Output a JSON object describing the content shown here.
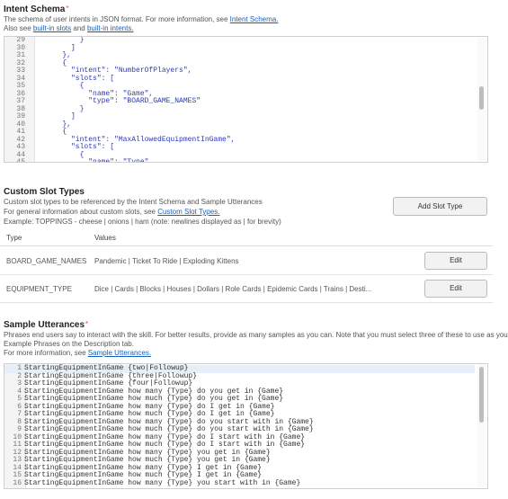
{
  "intent_schema": {
    "title": "Intent Schema",
    "required_mark": "*",
    "desc1_prefix": "The schema of user intents in JSON format. For more information, see ",
    "desc1_link": "Intent Schema.",
    "desc2_prefix": "Also see ",
    "desc2_link1": "built-in slots",
    "desc2_mid": " and ",
    "desc2_link2": "built-in intents.",
    "lines": [
      {
        "n": "29",
        "t": "            }"
      },
      {
        "n": "30",
        "t": "          ]"
      },
      {
        "n": "31",
        "t": "        },"
      },
      {
        "n": "32",
        "t": "        {"
      },
      {
        "n": "33",
        "t": "          \"intent\": \"NumberOfPlayers\","
      },
      {
        "n": "34",
        "t": "          \"slots\": ["
      },
      {
        "n": "35",
        "t": "            {"
      },
      {
        "n": "36",
        "t": "              \"name\": \"Game\","
      },
      {
        "n": "37",
        "t": "              \"type\": \"BOARD_GAME_NAMES\""
      },
      {
        "n": "38",
        "t": "            }"
      },
      {
        "n": "39",
        "t": "          ]"
      },
      {
        "n": "40",
        "t": "        },"
      },
      {
        "n": "41",
        "t": "        {"
      },
      {
        "n": "42",
        "t": "          \"intent\": \"MaxAllowedEquipmentInGame\","
      },
      {
        "n": "43",
        "t": "          \"slots\": ["
      },
      {
        "n": "44",
        "t": "            {"
      },
      {
        "n": "45",
        "t": "              \"name\": \"Type\","
      }
    ]
  },
  "custom_slot_types": {
    "title": "Custom Slot Types",
    "desc1": "Custom slot types to be referenced by the Intent Schema and Sample Utterances",
    "desc2_prefix": "For general information about custom slots, see ",
    "desc2_link": "Custom Slot Types.",
    "desc3": "Example: TOPPINGS - cheese | onions | ham (note: newlines displayed as | for brevity)",
    "add_button": "Add Slot Type",
    "col_type": "Type",
    "col_values": "Values",
    "rows": [
      {
        "type": "BOARD_GAME_NAMES",
        "values": "Pandemic | Ticket To Ride | Exploding Kittens",
        "edit": "Edit"
      },
      {
        "type": "EQUIPMENT_TYPE",
        "values": "Dice | Cards | Blocks | Houses | Dollars | Role Cards | Epidemic Cards | Trains | Desti...",
        "edit": "Edit"
      }
    ]
  },
  "sample_utterances": {
    "title": "Sample Utterances",
    "required_mark": "*",
    "desc1": "Phrases end users say to interact with the skill. For better results, provide as many samples as you can. Note that you must select three of these to use as your",
    "desc2": "Example Phrases on the Description tab.",
    "desc3_prefix": "For more information, see ",
    "desc3_link": "Sample Utterances.",
    "lines": [
      {
        "n": "1",
        "t": "StartingEquipmentInGame {two|Followup}"
      },
      {
        "n": "2",
        "t": "StartingEquipmentInGame {three|Followup}"
      },
      {
        "n": "3",
        "t": "StartingEquipmentInGame {four|Followup}"
      },
      {
        "n": "4",
        "t": "StartingEquipmentInGame how many {Type} do you get in {Game}"
      },
      {
        "n": "5",
        "t": "StartingEquipmentInGame how much {Type} do you get in {Game}"
      },
      {
        "n": "6",
        "t": "StartingEquipmentInGame how many {Type} do I get in {Game}"
      },
      {
        "n": "7",
        "t": "StartingEquipmentInGame how much {Type} do I get in {Game}"
      },
      {
        "n": "8",
        "t": "StartingEquipmentInGame how many {Type} do you start with in {Game}"
      },
      {
        "n": "9",
        "t": "StartingEquipmentInGame how much {Type} do you start with in {Game}"
      },
      {
        "n": "10",
        "t": "StartingEquipmentInGame how many {Type} do I start with in {Game}"
      },
      {
        "n": "11",
        "t": "StartingEquipmentInGame how much {Type} do I start with in {Game}"
      },
      {
        "n": "12",
        "t": "StartingEquipmentInGame how many {Type} you get in {Game}"
      },
      {
        "n": "13",
        "t": "StartingEquipmentInGame how much {Type} you get in {Game}"
      },
      {
        "n": "14",
        "t": "StartingEquipmentInGame how many {Type} I get in {Game}"
      },
      {
        "n": "15",
        "t": "StartingEquipmentInGame how much {Type} I get in {Game}"
      },
      {
        "n": "16",
        "t": "StartingEquipmentInGame how many {Type} you start with in {Game}"
      }
    ]
  }
}
